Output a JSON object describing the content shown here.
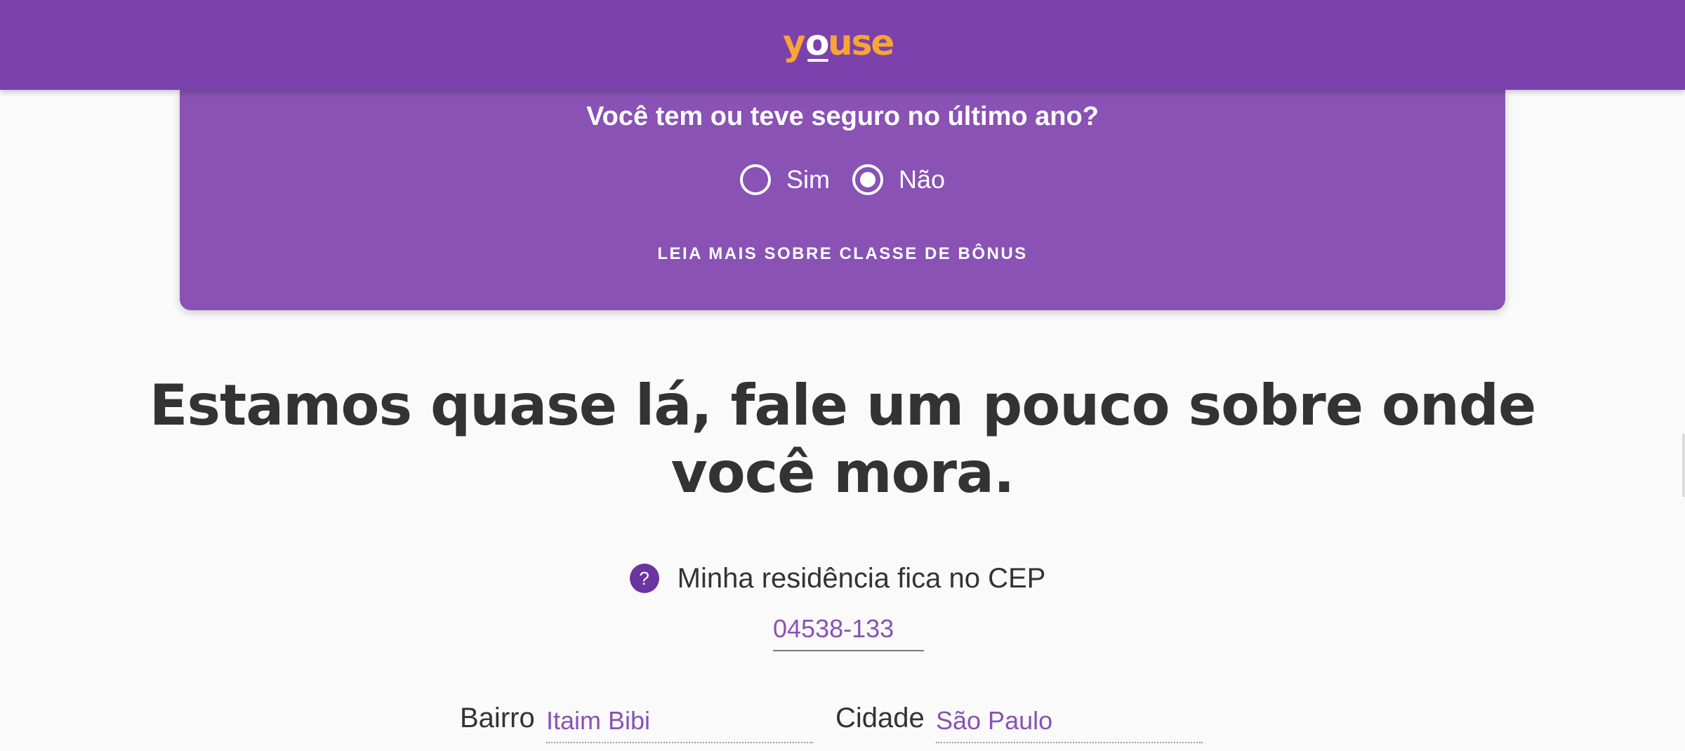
{
  "header": {
    "brand": "YOUSE",
    "logo_letters": [
      "y",
      "o",
      "u",
      "s",
      "e"
    ],
    "background_color": "#7b42ad",
    "logo_color": "#f9a534"
  },
  "bonus_card": {
    "question": "Você tem ou teve seguro no último ano?",
    "options": [
      {
        "label": "Sim",
        "selected": false
      },
      {
        "label": "Não",
        "selected": true
      }
    ],
    "link_text": "LEIA MAIS SOBRE CLASSE DE BÔNUS",
    "background_color": "#8952b4"
  },
  "address_section": {
    "headline": "Estamos quase lá, fale um pouco sobre onde você mora.",
    "help_icon": "question-mark-icon",
    "help_glyph": "?",
    "cep_label": "Minha residência fica no CEP",
    "cep_value": "04538-133",
    "neighborhood_label": "Bairro",
    "neighborhood_value": "Itaim Bibi",
    "city_label": "Cidade",
    "city_value": "São Paulo"
  },
  "colors": {
    "accent": "#8952b4",
    "text": "#333333",
    "page_background": "#fafafa"
  }
}
